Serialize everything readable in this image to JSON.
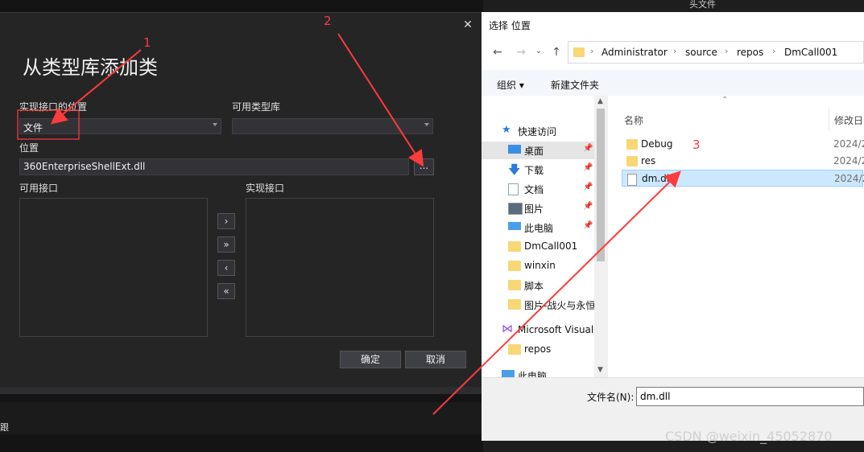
{
  "vs_dialog": {
    "title": "从类型库添加类",
    "close": "✕",
    "location_of_impl_label": "实现接口的位置",
    "location_of_impl_value": "文件",
    "available_typelib_label": "可用类型库",
    "available_typelib_value": "",
    "location_label": "位置",
    "location_value": "360EnterpriseShellExt.dll",
    "browse_label": "...",
    "available_interfaces_label": "可用接口",
    "implemented_interfaces_label": "实现接口",
    "move_right": "›",
    "move_all_right": "»",
    "move_left": "‹",
    "move_all_left": "«",
    "ok_label": "确定",
    "cancel_label": "取消",
    "bg_status_text": "跟"
  },
  "file_dialog": {
    "title": "选择 位置",
    "breadcrumbs": [
      "Administrator",
      "source",
      "repos",
      "DmCall001"
    ],
    "organize_label": "组织 ▾",
    "new_folder_label": "新建文件夹",
    "nav_items": [
      {
        "label": "快速访问",
        "icon": "star-icon",
        "pinned": false,
        "selected": false
      },
      {
        "label": "桌面",
        "icon": "desktop-icon",
        "pinned": true,
        "selected": true
      },
      {
        "label": "下载",
        "icon": "download-icon",
        "pinned": true,
        "selected": false
      },
      {
        "label": "文档",
        "icon": "document-icon",
        "pinned": true,
        "selected": false
      },
      {
        "label": "图片",
        "icon": "picture-icon",
        "pinned": true,
        "selected": false
      },
      {
        "label": "此电脑",
        "icon": "computer-icon",
        "pinned": true,
        "selected": false
      },
      {
        "label": "DmCall001",
        "icon": "folder-icon",
        "pinned": false,
        "selected": false
      },
      {
        "label": "winxin",
        "icon": "folder-icon",
        "pinned": false,
        "selected": false
      },
      {
        "label": "脚本",
        "icon": "folder-icon",
        "pinned": false,
        "selected": false
      },
      {
        "label": "图片-战火与永恒",
        "icon": "folder-icon",
        "pinned": false,
        "selected": false
      },
      {
        "label": "Microsoft Visual",
        "icon": "visual-studio-icon",
        "pinned": false,
        "selected": false
      },
      {
        "label": "repos",
        "icon": "folder-icon",
        "pinned": false,
        "selected": false
      },
      {
        "label": "此电脑",
        "icon": "computer-icon",
        "pinned": false,
        "selected": false
      }
    ],
    "columns": {
      "name": "名称",
      "modified": "修改日"
    },
    "files": [
      {
        "name": "Debug",
        "type": "folder",
        "date": "2024/2"
      },
      {
        "name": "res",
        "type": "folder",
        "date": "2024/2"
      },
      {
        "name": "dm.dll",
        "type": "dll",
        "date": "2024/2",
        "selected": true
      }
    ],
    "filename_label": "文件名(N):",
    "filename_value": "dm.dll"
  },
  "annotations": {
    "step1": "1",
    "step2": "2",
    "step3": "3",
    "color": "#ff3b3b"
  },
  "watermark": "CSDN @weixin_45052870",
  "bg_top_text": "头文件"
}
